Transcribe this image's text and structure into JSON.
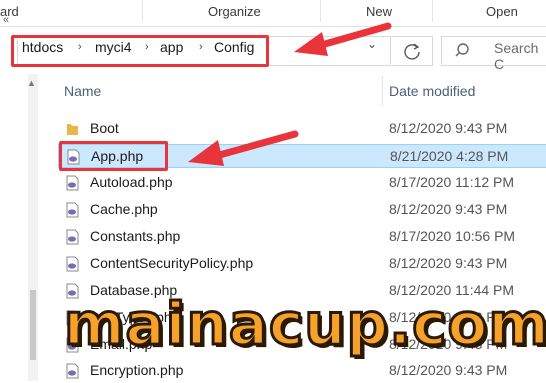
{
  "ribbon": {
    "groups": [
      "ard",
      "Organize",
      "New",
      "Open"
    ]
  },
  "address_bar": {
    "breadcrumbs": [
      "htdocs",
      "myci4",
      "app",
      "Config"
    ],
    "search_placeholder": "Search C"
  },
  "columns": {
    "name": "Name",
    "date_modified": "Date modified"
  },
  "files": [
    {
      "name": "Boot",
      "date": "8/12/2020 9:43 PM",
      "type": "folder"
    },
    {
      "name": "App.php",
      "date": "8/21/2020 4:28 PM",
      "type": "php",
      "selected": true
    },
    {
      "name": "Autoload.php",
      "date": "8/17/2020 11:12 PM",
      "type": "php"
    },
    {
      "name": "Cache.php",
      "date": "8/12/2020 9:43 PM",
      "type": "php"
    },
    {
      "name": "Constants.php",
      "date": "8/17/2020 10:56 PM",
      "type": "php"
    },
    {
      "name": "ContentSecurityPolicy.php",
      "date": "8/12/2020 9:43 PM",
      "type": "php"
    },
    {
      "name": "Database.php",
      "date": "8/12/2020 11:44 PM",
      "type": "php"
    },
    {
      "name": "DocTypes.php",
      "date": "8/12/2020 9:43 PM",
      "type": "php"
    },
    {
      "name": "Email.php",
      "date": "8/12/2020 9:43 PM",
      "type": "php"
    },
    {
      "name": "Encryption.php",
      "date": "8/12/2020 9:43 PM",
      "type": "php"
    }
  ],
  "watermark": "mainacup.com",
  "colors": {
    "highlight": "#e8343a",
    "selection": "#cce8ff",
    "watermark_fill": "#f6a22a",
    "folder": "#e8b94a",
    "php_icon": "#7b6bb5"
  }
}
